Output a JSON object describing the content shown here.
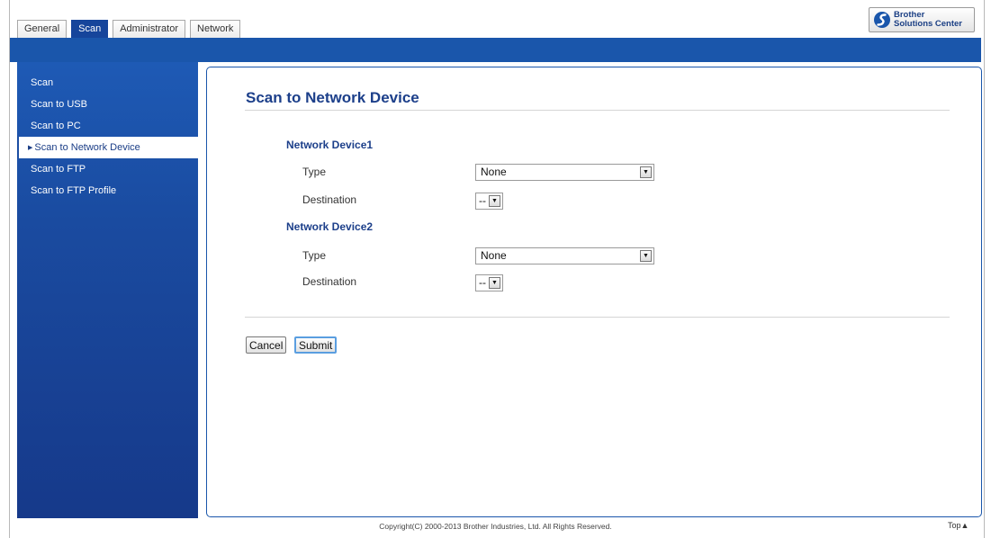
{
  "tabs": [
    {
      "label": "General",
      "active": false
    },
    {
      "label": "Scan",
      "active": true
    },
    {
      "label": "Administrator",
      "active": false
    },
    {
      "label": "Network",
      "active": false
    }
  ],
  "solutions_center": {
    "line1": "Brother",
    "line2": "Solutions Center",
    "icon": "brother-swoosh-logo"
  },
  "sidebar": {
    "items": [
      {
        "label": "Scan",
        "active": false
      },
      {
        "label": "Scan to USB",
        "active": false
      },
      {
        "label": "Scan to PC",
        "active": false
      },
      {
        "label": "Scan to Network Device",
        "active": true
      },
      {
        "label": "Scan to FTP",
        "active": false
      },
      {
        "label": "Scan to FTP Profile",
        "active": false
      }
    ]
  },
  "main": {
    "title": "Scan to Network Device",
    "devices": [
      {
        "name": "Network Device1",
        "type_label": "Type",
        "type_value": "None",
        "destination_label": "Destination",
        "destination_value": "--"
      },
      {
        "name": "Network Device2",
        "type_label": "Type",
        "type_value": "None",
        "destination_label": "Destination",
        "destination_value": "--"
      }
    ],
    "cancel_label": "Cancel",
    "submit_label": "Submit"
  },
  "footer": {
    "copyright": "Copyright(C) 2000-2013 Brother Industries, Ltd. All Rights Reserved.",
    "top_link": "Top"
  },
  "colors": {
    "brand_blue": "#1a56ab",
    "title_blue": "#1c3f8a"
  }
}
